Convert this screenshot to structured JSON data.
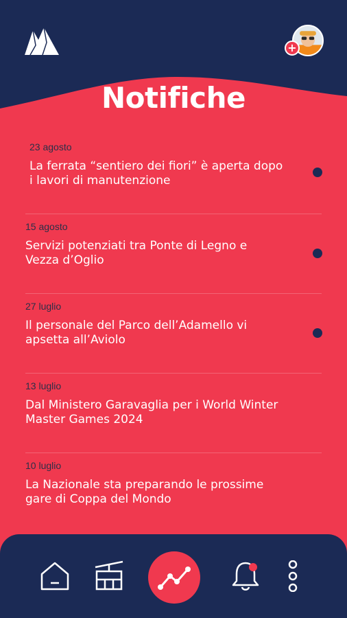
{
  "header": {
    "title": "Notifiche",
    "logo_icon": "mountain-logo-icon",
    "avatar_add_symbol": "+"
  },
  "notifications": [
    {
      "date": "23 agosto",
      "text": "La ferrata “sentiero dei fiori” è aperta dopo i lavori di manutenzione",
      "unread": true
    },
    {
      "date": "15 agosto",
      "text": "Servizi potenziati tra Ponte di Legno e Vezza d’Oglio",
      "unread": true
    },
    {
      "date": "27 luglio",
      "text": "Il personale del Parco dell’Adamello vi apsetta all’Aviolo",
      "unread": true
    },
    {
      "date": "13 luglio",
      "text": "Dal Ministero Garavaglia per i World Winter Master Games 2024",
      "unread": false
    },
    {
      "date": "10 luglio",
      "text": "La Nazionale sta preparando le prossime gare di Coppa del Mondo",
      "unread": false
    }
  ],
  "bottom_nav": {
    "items": [
      "home-icon",
      "cable-car-icon",
      "trend-chart-icon",
      "bell-icon",
      "more-vertical-icon"
    ]
  },
  "colors": {
    "navy": "#1b2a55",
    "red": "#f0394f",
    "white": "#ffffff"
  }
}
